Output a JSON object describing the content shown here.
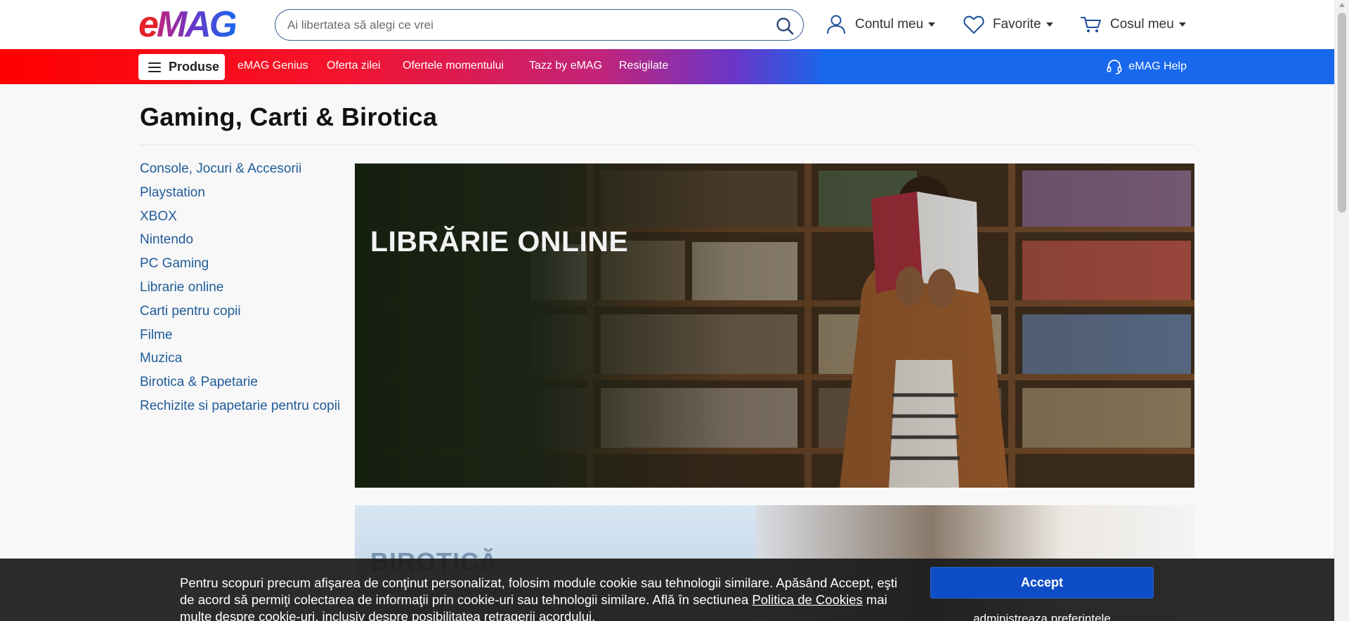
{
  "header": {
    "logo_e": "e",
    "logo_mag": "MAG",
    "search_placeholder": "Ai libertatea să alegi ce vrei",
    "account_label": "Contul meu",
    "favorites_label": "Favorite",
    "cart_label": "Cosul meu"
  },
  "nav": {
    "produse_label": "Produse",
    "links": [
      "eMAG Genius",
      "Oferta zilei",
      "Ofertele momentului",
      "Tazz by eMAG",
      "Resigilate"
    ],
    "help_label": "eMAG Help"
  },
  "main": {
    "page_title": "Gaming, Carti & Birotica",
    "categories": [
      "Console, Jocuri & Accesorii",
      "Playstation",
      "XBOX",
      "Nintendo",
      "PC Gaming",
      "Librarie online",
      "Carti pentru copii",
      "Filme",
      "Muzica",
      "Birotica & Papetarie",
      "Rechizite si papetarie pentru copii"
    ],
    "hero_banner_title": "LIBRĂRIE ONLINE",
    "second_banner_title": "BIROTICĂ"
  },
  "cookie": {
    "text_before_link": "Pentru scopuri precum afişarea de conţinut personalizat, folosim module cookie sau tehnologii similare. Apăsând Accept, eşti de acord să permiţi colectarea de informaţii prin cookie-uri sau tehnologii similare. Află în sectiunea ",
    "link_text": "Politica de Cookies",
    "text_after_link": " mai multe despre cookie-uri, inclusiv despre posibilitatea retragerii acordului.",
    "accept_label": "Accept",
    "preferences_label": "administreaza preferintele"
  },
  "colors": {
    "brand_red": "#e5222b",
    "brand_blue": "#1768ec",
    "link_blue": "#1f5b99",
    "accept_blue": "#0f4dc7"
  }
}
